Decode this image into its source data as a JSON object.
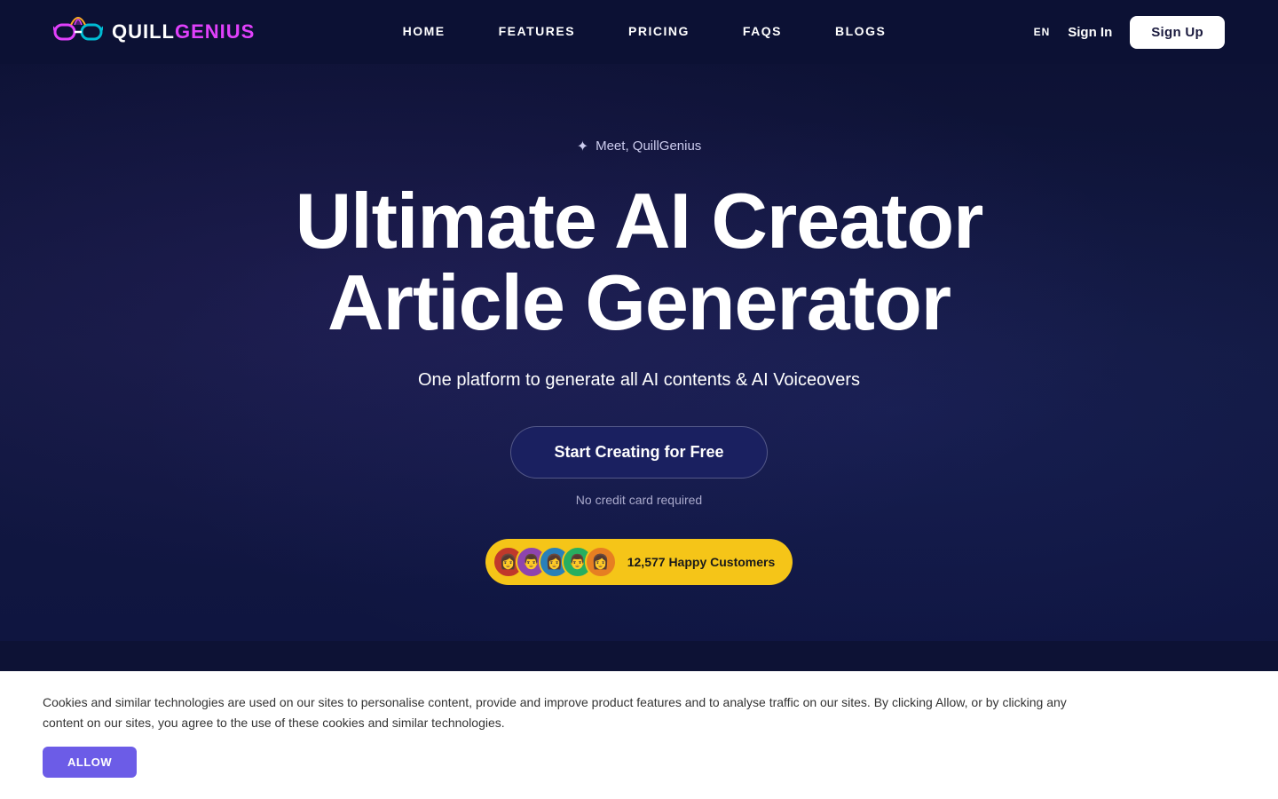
{
  "brand": {
    "name_quill": "QUILL",
    "name_genius": "GENIUS",
    "full_name": "QUILLGENIUS"
  },
  "navbar": {
    "lang": "EN",
    "sign_in_label": "Sign In",
    "sign_up_label": "Sign Up",
    "links": [
      {
        "id": "home",
        "label": "HOME"
      },
      {
        "id": "features",
        "label": "FEATURES"
      },
      {
        "id": "pricing",
        "label": "PRICING"
      },
      {
        "id": "faqs",
        "label": "FAQS"
      },
      {
        "id": "blogs",
        "label": "BLOGS"
      }
    ]
  },
  "hero": {
    "meet_label": "Meet, QuillGenius",
    "title_line1": "Ultimate AI Creator",
    "title_line2": "Article Generator",
    "subtitle": "One platform to generate all AI contents & AI Voiceovers",
    "cta_label": "Start Creating for Free",
    "no_credit_label": "No credit card required",
    "happy_customers_count": "12,577 Happy Customers"
  },
  "cookie": {
    "text": "Cookies and similar technologies are used on our sites to personalise content, provide and improve product features and to analyse traffic on our sites. By clicking Allow, or by clicking any content on our sites, you agree to the use of these cookies and similar technologies.",
    "allow_label": "ALLOW"
  },
  "icons": {
    "sparkle": "✦",
    "logo_emoji": "🥸"
  },
  "avatars": [
    {
      "id": 1,
      "emoji": "👩"
    },
    {
      "id": 2,
      "emoji": "👨"
    },
    {
      "id": 3,
      "emoji": "👩"
    },
    {
      "id": 4,
      "emoji": "👨"
    },
    {
      "id": 5,
      "emoji": "👩"
    }
  ]
}
